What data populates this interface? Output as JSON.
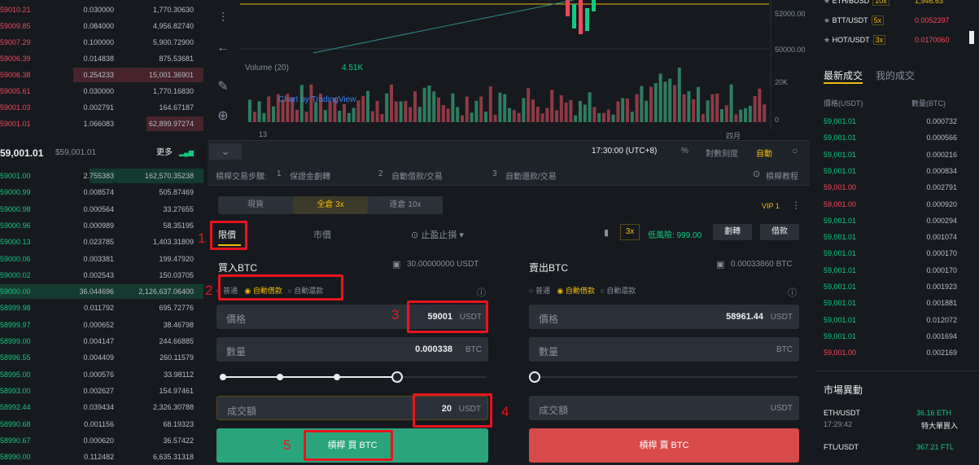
{
  "orderbook": {
    "asks": [
      {
        "price": "59010.21",
        "amount": "0.030000",
        "total": "1,770.30630"
      },
      {
        "price": "59009.85",
        "amount": "0.084000",
        "total": "4,956.82740"
      },
      {
        "price": "59007.29",
        "amount": "0.100000",
        "total": "5,900.72900"
      },
      {
        "price": "59006.39",
        "amount": "0.014838",
        "total": "875.53681"
      },
      {
        "price": "59006.38",
        "amount": "0.254233",
        "total": "15,001.36901"
      },
      {
        "price": "59005.61",
        "amount": "0.030000",
        "total": "1,770.16830"
      },
      {
        "price": "59001.03",
        "amount": "0.002791",
        "total": "164.67187"
      },
      {
        "price": "59001.01",
        "amount": "1.066083",
        "total": "62,899.97274"
      }
    ],
    "mid_price": "59,001.01",
    "mid_price_usd": "$59,001.01",
    "more_label": "更多",
    "bids": [
      {
        "price": "59001.00",
        "amount": "2.755383",
        "total": "162,570.35238"
      },
      {
        "price": "59000.99",
        "amount": "0.008574",
        "total": "505.87469"
      },
      {
        "price": "59000.98",
        "amount": "0.000564",
        "total": "33.27655"
      },
      {
        "price": "59000.96",
        "amount": "0.000989",
        "total": "58.35195"
      },
      {
        "price": "59000.13",
        "amount": "0.023785",
        "total": "1,403.31809"
      },
      {
        "price": "59000.06",
        "amount": "0.003381",
        "total": "199.47920"
      },
      {
        "price": "59000.02",
        "amount": "0.002543",
        "total": "150.03705"
      },
      {
        "price": "59000.00",
        "amount": "36.044696",
        "total": "2,126,637.06400"
      },
      {
        "price": "58999.98",
        "amount": "0.011792",
        "total": "695.72776"
      },
      {
        "price": "58999.97",
        "amount": "0.000652",
        "total": "38.46798"
      },
      {
        "price": "58999.00",
        "amount": "0.004147",
        "total": "244.66885"
      },
      {
        "price": "58996.55",
        "amount": "0.004409",
        "total": "260.11579"
      },
      {
        "price": "58995.00",
        "amount": "0.000576",
        "total": "33.98112"
      },
      {
        "price": "58993.00",
        "amount": "0.002627",
        "total": "154.97461"
      },
      {
        "price": "58992.44",
        "amount": "0.039434",
        "total": "2,326.30788"
      },
      {
        "price": "58990.68",
        "amount": "0.001156",
        "total": "68.19323"
      },
      {
        "price": "58990.67",
        "amount": "0.000620",
        "total": "36.57422"
      },
      {
        "price": "58990.00",
        "amount": "0.112482",
        "total": "6,635.31318"
      }
    ]
  },
  "chart": {
    "price_labels": [
      "52000.00",
      "50000.00"
    ],
    "volume_labels": [
      "20K",
      "0"
    ],
    "volume_title": "Volume (20)",
    "volume_value": "4.51K",
    "tradingview": "Chart by TradingView",
    "x_labels": [
      "13",
      "四月"
    ],
    "time": "17:30:00 (UTC+8)",
    "pct": "%",
    "log": "對數刻度",
    "auto": "自動"
  },
  "steps": {
    "title": "槓桿交易步驟:",
    "step1_num": "1",
    "step1": "保證金劃轉",
    "step2_num": "2",
    "step2": "自動借款/交易",
    "step3_num": "3",
    "step3": "自動還款/交易",
    "tutorial": "槓桿教程"
  },
  "trade": {
    "tabs": [
      "現貨",
      "全倉 3x",
      "逐倉 10x"
    ],
    "vip": "VIP 1",
    "order_types": [
      "限價",
      "市價",
      "止盈止損"
    ],
    "leverage": "3x",
    "risk_label": "低風險: 999.00",
    "transfer": "劃轉",
    "borrow": "借款",
    "buy": {
      "title": "買入BTC",
      "balance": "30.00000000 USDT",
      "modes": [
        "普通",
        "自動借款",
        "自動還款"
      ],
      "price_label": "價格",
      "price": "59001",
      "price_unit": "USDT",
      "amount_label": "數量",
      "amount": "0.000338",
      "amount_unit": "BTC",
      "total_label": "成交額",
      "total": "20",
      "total_unit": "USDT",
      "button": "槓桿 買 BTC"
    },
    "sell": {
      "title": "賣出BTC",
      "balance": "0.00033860 BTC",
      "modes": [
        "普通",
        "自動借款",
        "自動還款"
      ],
      "price_label": "價格",
      "price": "58961.44",
      "price_unit": "USDT",
      "amount_label": "數量",
      "amount": "",
      "amount_unit": "BTC",
      "total_label": "成交額",
      "total": "",
      "total_unit": "USDT",
      "button": "槓桿 賣 BTC"
    }
  },
  "annotations": [
    "1",
    "2",
    "3",
    "4",
    "5"
  ],
  "right": {
    "markets": [
      {
        "name": "ETH/BUSD",
        "lev": "10x",
        "price": "1,946.63"
      },
      {
        "name": "BTT/USDT",
        "lev": "5x",
        "price": "0.0052397"
      },
      {
        "name": "HOT/USDT",
        "lev": "3x",
        "price": "0.0170060"
      }
    ],
    "tabs": [
      "最新成交",
      "我的成交"
    ],
    "headers": [
      "價格(USDT)",
      "數量(BTC)"
    ],
    "trades": [
      {
        "price": "59,001.01",
        "amount": "0.000732",
        "side": "buy"
      },
      {
        "price": "59,001.01",
        "amount": "0.000566",
        "side": "buy"
      },
      {
        "price": "59,001.01",
        "amount": "0.000216",
        "side": "buy"
      },
      {
        "price": "59,001.01",
        "amount": "0.000834",
        "side": "buy"
      },
      {
        "price": "59,001.00",
        "amount": "0.002791",
        "side": "sell"
      },
      {
        "price": "59,001.00",
        "amount": "0.000920",
        "side": "sell"
      },
      {
        "price": "59,001.01",
        "amount": "0.000294",
        "side": "buy"
      },
      {
        "price": "59,001.01",
        "amount": "0.001074",
        "side": "buy"
      },
      {
        "price": "59,001.01",
        "amount": "0.000170",
        "side": "buy"
      },
      {
        "price": "59,001.01",
        "amount": "0.000170",
        "side": "buy"
      },
      {
        "price": "59,001.01",
        "amount": "0.001923",
        "side": "buy"
      },
      {
        "price": "59,001.01",
        "amount": "0.001881",
        "side": "buy"
      },
      {
        "price": "59,001.01",
        "amount": "0.012072",
        "side": "buy"
      },
      {
        "price": "59,001.01",
        "amount": "0.001694",
        "side": "buy"
      },
      {
        "price": "59,001.00",
        "amount": "0.002169",
        "side": "sell"
      }
    ],
    "market_moves_title": "市場異動",
    "moves": [
      {
        "pair": "ETH/USDT",
        "time": "17:29:42",
        "value": "36.16 ETH",
        "desc": "特大單買入"
      },
      {
        "pair": "FTL/USDT",
        "time": "",
        "value": "367.21 FTL",
        "desc": ""
      }
    ]
  }
}
